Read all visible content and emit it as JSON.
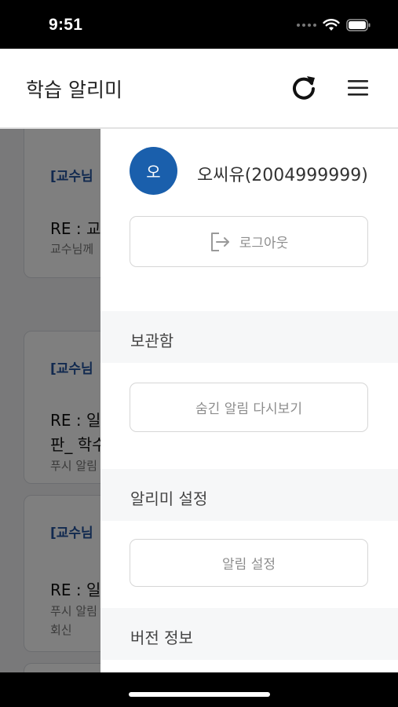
{
  "status_bar": {
    "time": "9:51"
  },
  "header": {
    "title": "학습 알리미"
  },
  "background_cards": [
    {
      "tag": "[교수님",
      "title": "RE : 교",
      "sub": "교수님께"
    },
    {
      "tag": "[교수님",
      "title": "RE : 일",
      "title2": "판_ 학수",
      "sub": "푸시 알림"
    },
    {
      "tag": "[교수님",
      "title": "RE : 일",
      "sub": "푸시 알림",
      "sub2": "회신"
    }
  ],
  "drawer": {
    "avatar_initial": "오",
    "user_name": "오씨유(2004999999)",
    "logout_label": "로그아웃",
    "sections": [
      {
        "title": "보관함",
        "button": "숨긴 알림 다시보기"
      },
      {
        "title": "알리미 설정",
        "button": "알림 설정"
      },
      {
        "title": "버전 정보"
      }
    ]
  },
  "colors": {
    "avatar": "#1a5fac",
    "tag": "#22539e",
    "overlay": "rgba(0,0,0,0.5)"
  }
}
